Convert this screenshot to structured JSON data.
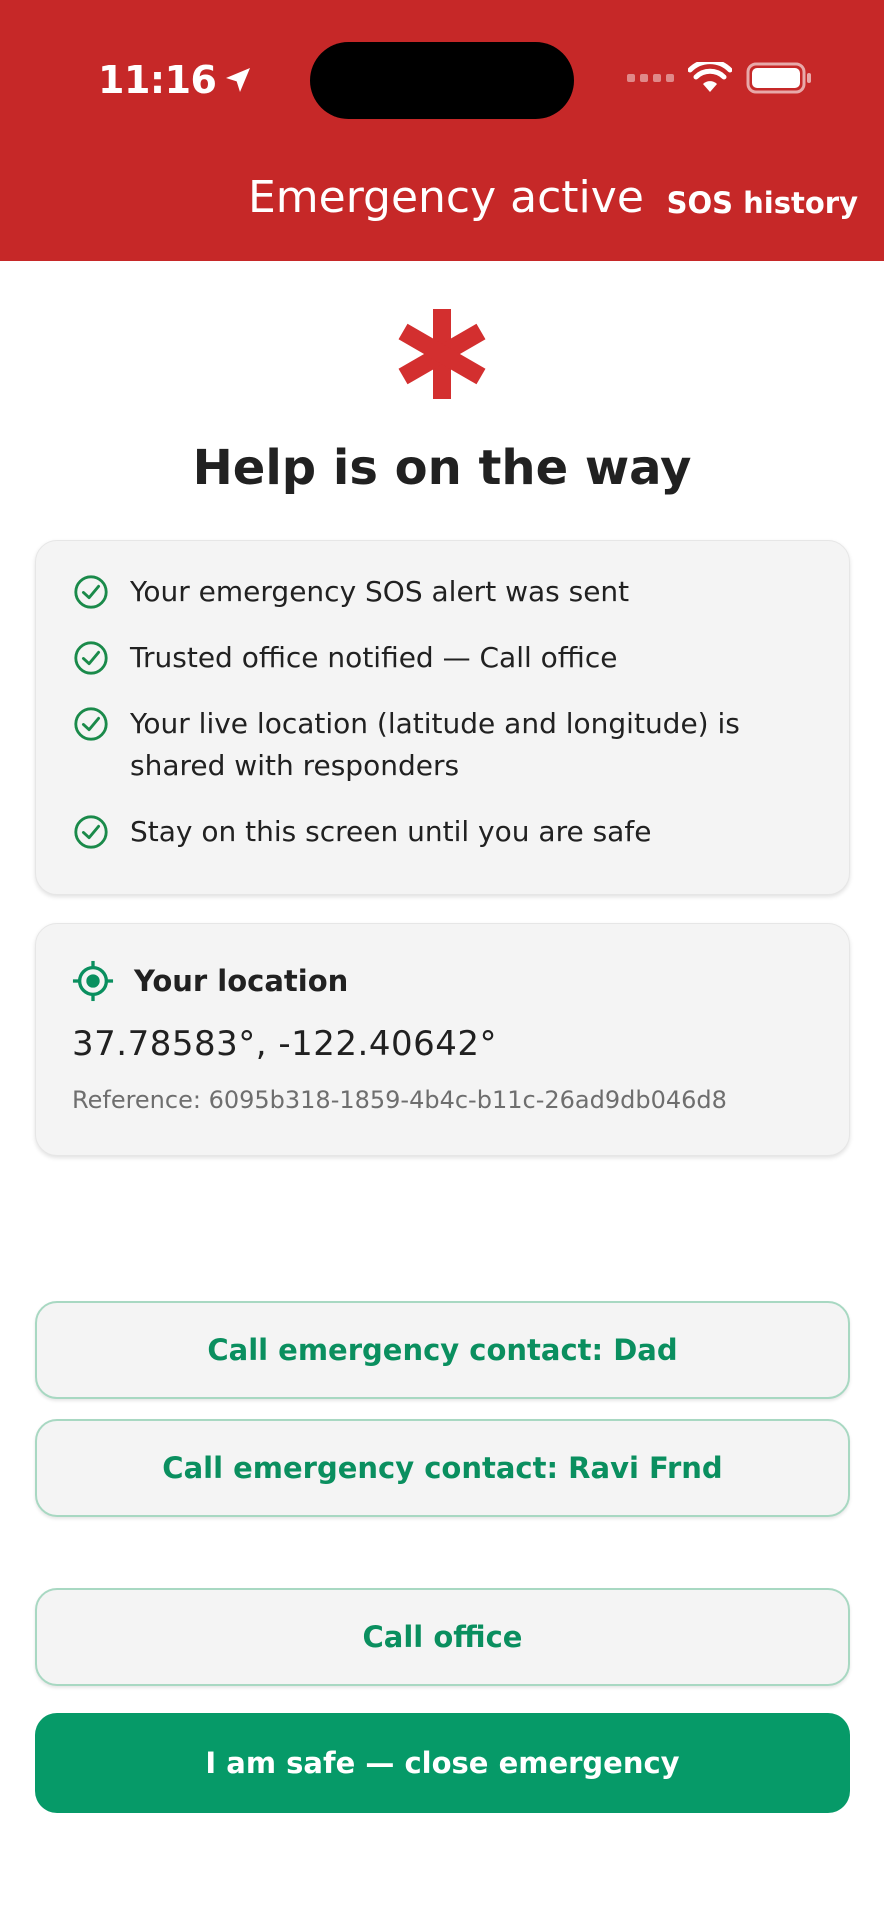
{
  "status_bar": {
    "time": "11:16"
  },
  "app_bar": {
    "title": "Emergency active",
    "history_label": "SOS history"
  },
  "accent_colors": {
    "header": "#c62828",
    "success": "#069a68",
    "check": "#1a8a4a"
  },
  "icons": [
    "location-arrow-icon",
    "wifi-icon",
    "battery-icon",
    "asterisk-icon",
    "check-circle-icon",
    "location-target-icon"
  ],
  "headline": "Help is on the way",
  "status_list": [
    {
      "text": "Your emergency SOS alert was sent"
    },
    {
      "text": "Trusted office notified — Call office"
    },
    {
      "text": "Your live location (latitude and longitude) is shared with responders"
    },
    {
      "text": "Stay on this screen until you are safe"
    }
  ],
  "location": {
    "title": "Your location",
    "coordinates": "37.78583°, -122.40642°",
    "reference": "Reference: 6095b318-1859-4b4c-b11c-26ad9db046d8"
  },
  "buttons": {
    "contact_dad": "Call emergency contact: Dad",
    "contact_ravi": "Call emergency contact: Ravi Frnd",
    "call_office": "Call office",
    "safe": "I am safe — close emergency"
  }
}
